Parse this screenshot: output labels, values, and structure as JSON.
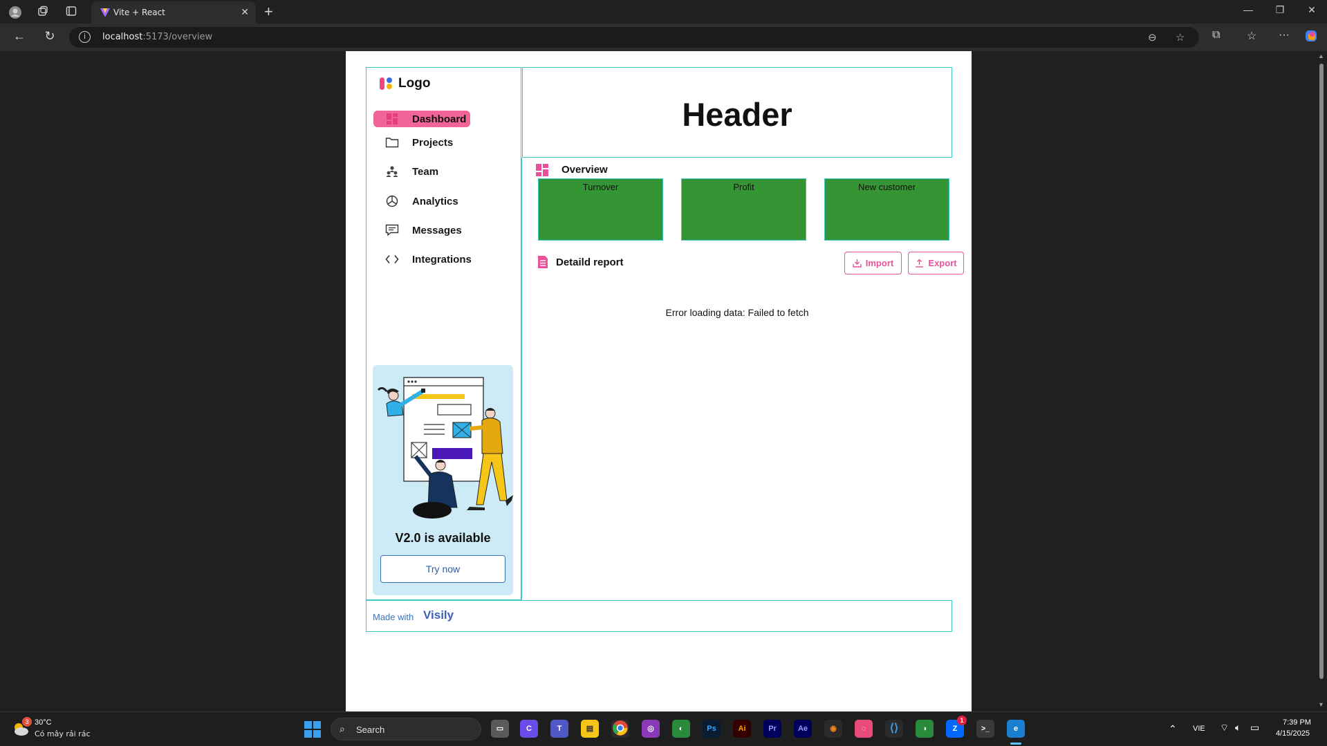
{
  "browser": {
    "tab_title": "Vite + React",
    "url_host": "localhost",
    "url_path": ":5173/overview"
  },
  "sidebar": {
    "logo_text": "Logo",
    "items": [
      {
        "label": "Dashboard",
        "icon": "dashboard-icon",
        "active": true
      },
      {
        "label": "Projects",
        "icon": "folder-icon",
        "active": false
      },
      {
        "label": "Team",
        "icon": "team-icon",
        "active": false
      },
      {
        "label": "Analytics",
        "icon": "pie-chart-icon",
        "active": false
      },
      {
        "label": "Messages",
        "icon": "message-icon",
        "active": false
      },
      {
        "label": "Integrations",
        "icon": "code-icon",
        "active": false
      }
    ],
    "promo": {
      "title": "V2.0 is available",
      "button": "Try now"
    }
  },
  "header": {
    "title": "Header"
  },
  "overview": {
    "title": "Overview",
    "cards": [
      "Turnover",
      "Profit",
      "New customer"
    ]
  },
  "report": {
    "title": "Detaild report",
    "import_label": "Import",
    "export_label": "Export",
    "error_message": "Error loading data: Failed to fetch"
  },
  "footer": {
    "made_with": "Made with",
    "brand": "Visily"
  },
  "taskbar": {
    "weather_temp": "30°C",
    "weather_desc": "Có mây rải rác",
    "weather_badge": "3",
    "search_label": "Search",
    "language": "VIE",
    "time": "7:39 PM",
    "date": "4/15/2025",
    "zalo_badge": "1"
  },
  "colors": {
    "accent_pink": "#f16497",
    "outline_teal": "#3cc8c8",
    "card_green": "#359535",
    "promo_bg": "#cdebf6"
  }
}
